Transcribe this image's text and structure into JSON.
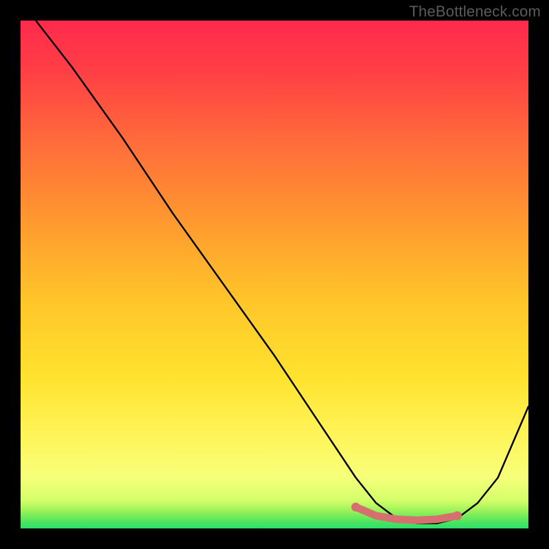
{
  "watermark": "TheBottleneck.com",
  "chart_data": {
    "type": "line",
    "title": "",
    "xlabel": "",
    "ylabel": "",
    "xlim": [
      0,
      100
    ],
    "ylim": [
      0,
      100
    ],
    "grid": false,
    "legend": false,
    "background_gradient": {
      "top_color": "#ff2a4d",
      "mid_color": "#ffd633",
      "low_color": "#ffff8a",
      "bottom_color": "#28e06a"
    },
    "series": [
      {
        "name": "bottleneck-curve",
        "color": "#000000",
        "stroke_width": 2.5,
        "x": [
          3,
          10,
          20,
          30,
          40,
          50,
          60,
          66,
          70,
          74,
          78,
          82,
          86,
          90,
          94,
          100
        ],
        "values": [
          100,
          91,
          77,
          62,
          48,
          34,
          19,
          10,
          5,
          2,
          1,
          1,
          2,
          5,
          10,
          24
        ]
      },
      {
        "name": "highlight-band",
        "color": "#d6706e",
        "stroke_width": 11,
        "x": [
          66,
          70,
          74,
          78,
          82,
          86
        ],
        "values": [
          4.2,
          2.5,
          1.8,
          1.6,
          1.8,
          2.5
        ]
      }
    ]
  }
}
